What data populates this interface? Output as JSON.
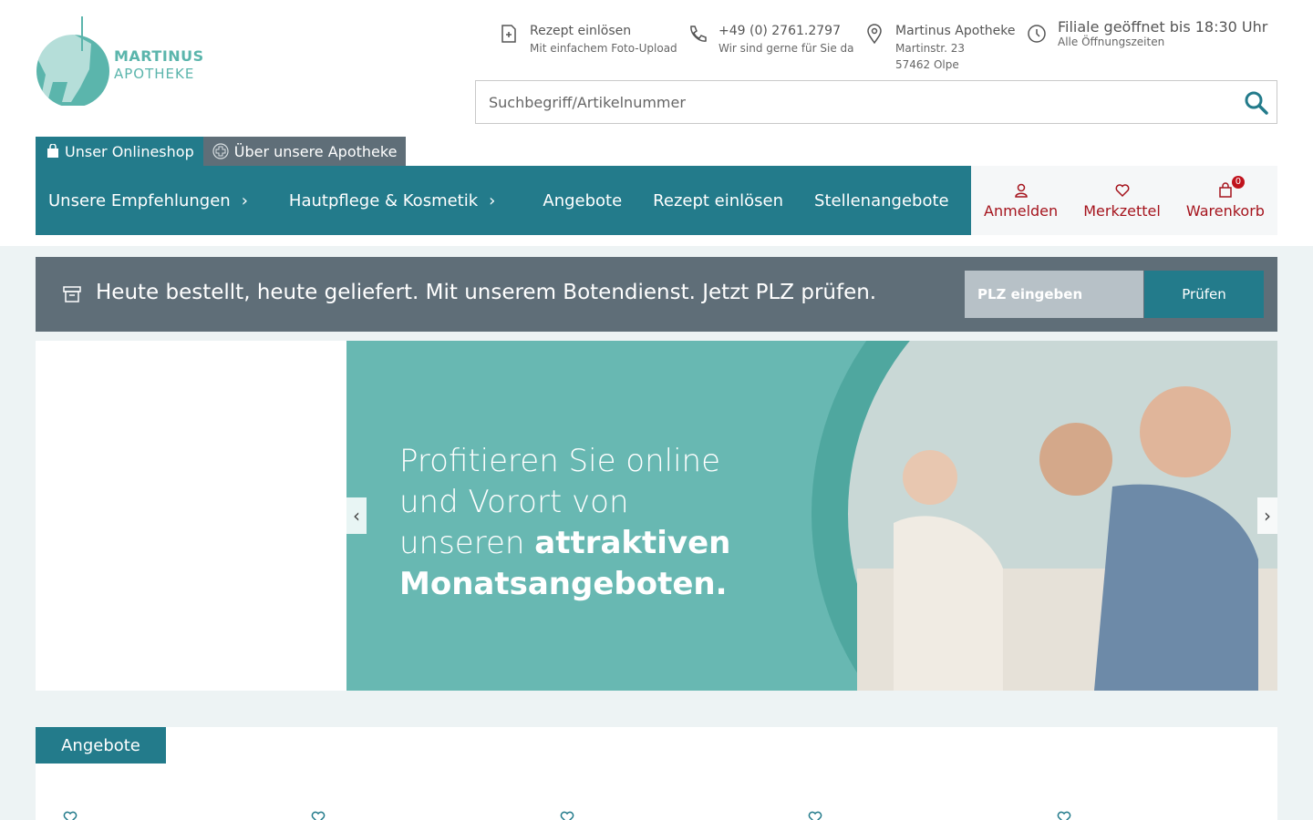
{
  "brand": {
    "line1": "MARTINUS",
    "line2": "APOTHEKE",
    "color": "#5bb5ac"
  },
  "header_info": [
    {
      "icon": "prescription-icon",
      "title": "Rezept einlösen",
      "sub": "Mit einfachem Foto-Upload"
    },
    {
      "icon": "phone-icon",
      "title": "+49 (0) 2761.2797",
      "sub": "Wir sind gerne für Sie da"
    },
    {
      "icon": "location-icon",
      "title": "Martinus Apotheke",
      "sub": "Martinstr. 23",
      "sub2": "57462 Olpe"
    },
    {
      "icon": "clock-icon",
      "title": "Filiale geöffnet bis 18:30 Uhr",
      "sub": "Alle Öffnungszeiten"
    }
  ],
  "search": {
    "placeholder": "Suchbegriff/Artikelnummer"
  },
  "top_tabs": {
    "shop": "Unser Onlineshop",
    "about": "Über unsere Apotheke"
  },
  "nav": [
    {
      "label": "Unsere Empfehlungen",
      "has_submenu": true
    },
    {
      "label": "Hautpflege & Kosmetik",
      "has_submenu": true
    },
    {
      "label": "Angebote",
      "has_submenu": false
    },
    {
      "label": "Rezept einlösen",
      "has_submenu": false
    },
    {
      "label": "Stellenangebote",
      "has_submenu": false
    }
  ],
  "user_nav": {
    "login": "Anmelden",
    "wishlist": "Merkzettel",
    "cart": "Warenkorb",
    "cart_count": "0"
  },
  "delivery": {
    "text": "Heute bestellt, heute geliefert. Mit unserem Botendienst. Jetzt PLZ prüfen.",
    "placeholder": "PLZ eingeben",
    "button": "Prüfen"
  },
  "banner": {
    "line1": "Profitieren Sie online",
    "line2": "und Vorort von",
    "line3_a": "unseren ",
    "line3_b": "attraktiven",
    "line4": "Monatsangeboten."
  },
  "offers": {
    "title": "Angebote"
  },
  "colors": {
    "primary": "#237b8b",
    "slate": "#5f6e78",
    "accent_red": "#a5141d"
  }
}
